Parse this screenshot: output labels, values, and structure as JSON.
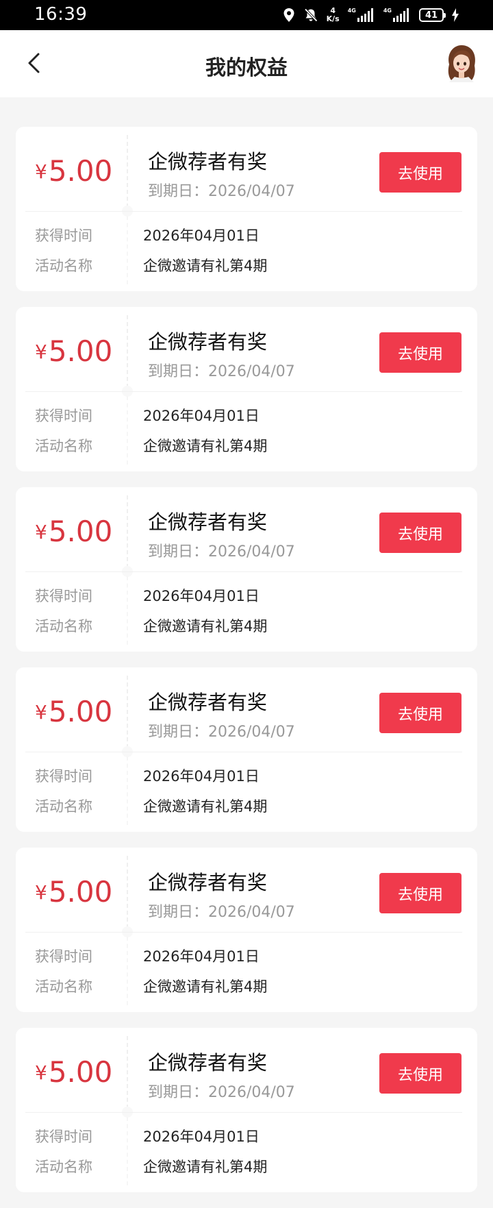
{
  "status_bar": {
    "time": "16:39",
    "net_speed_value": "4",
    "net_speed_unit": "K/s",
    "sim1_label": "4G",
    "sim2_label": "4G",
    "battery": "41",
    "icons": [
      "location-icon",
      "bell-muted-icon",
      "signal-icon",
      "battery-icon",
      "charging-icon"
    ]
  },
  "header": {
    "title": "我的权益",
    "back_icon": "chevron-left-icon",
    "avatar_icon": "avatar"
  },
  "coupons": [
    {
      "currency": "¥",
      "amount": "5.00",
      "name": "企微荐者有奖",
      "expiry": "到期日：2026/04/07",
      "button": "去使用",
      "label_time": "获得时间",
      "time": "2026年04月01日",
      "label_activity": "活动名称",
      "activity": "企微邀请有礼第4期"
    },
    {
      "currency": "¥",
      "amount": "5.00",
      "name": "企微荐者有奖",
      "expiry": "到期日：2026/04/07",
      "button": "去使用",
      "label_time": "获得时间",
      "time": "2026年04月01日",
      "label_activity": "活动名称",
      "activity": "企微邀请有礼第4期"
    },
    {
      "currency": "¥",
      "amount": "5.00",
      "name": "企微荐者有奖",
      "expiry": "到期日：2026/04/07",
      "button": "去使用",
      "label_time": "获得时间",
      "time": "2026年04月01日",
      "label_activity": "活动名称",
      "activity": "企微邀请有礼第4期"
    },
    {
      "currency": "¥",
      "amount": "5.00",
      "name": "企微荐者有奖",
      "expiry": "到期日：2026/04/07",
      "button": "去使用",
      "label_time": "获得时间",
      "time": "2026年04月01日",
      "label_activity": "活动名称",
      "activity": "企微邀请有礼第4期"
    },
    {
      "currency": "¥",
      "amount": "5.00",
      "name": "企微荐者有奖",
      "expiry": "到期日：2026/04/07",
      "button": "去使用",
      "label_time": "获得时间",
      "time": "2026年04月01日",
      "label_activity": "活动名称",
      "activity": "企微邀请有礼第4期"
    },
    {
      "currency": "¥",
      "amount": "5.00",
      "name": "企微荐者有奖",
      "expiry": "到期日：2026/04/07",
      "button": "去使用",
      "label_time": "获得时间",
      "time": "2026年04月01日",
      "label_activity": "活动名称",
      "activity": "企微邀请有礼第4期"
    }
  ],
  "colors": {
    "accent_red": "#d8353f",
    "button_red": "#f03a4c",
    "page_bg": "#f5f5f5"
  }
}
